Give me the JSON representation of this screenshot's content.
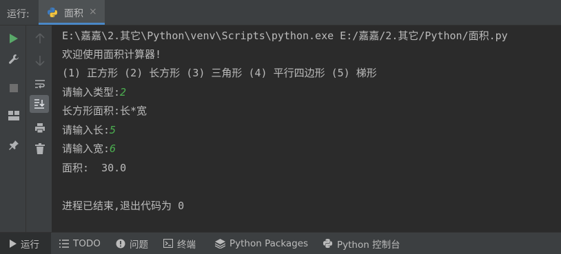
{
  "topbar": {
    "run_label": "运行:",
    "tab_title": "面积",
    "tab_close": "×"
  },
  "console": {
    "lines": [
      "E:\\嘉嘉\\2.其它\\Python\\venv\\Scripts\\python.exe E:/嘉嘉/2.其它/Python/面积.py",
      "欢迎使用面积计算器!",
      "(1) 正方形 (2) 长方形 (3) 三角形 (4) 平行四边形 (5) 梯形",
      "请输入类型:",
      "长方形面积:长*宽",
      "请输入长:",
      "请输入宽:",
      "面积:  30.0",
      "",
      "进程已结束,退出代码为 0"
    ],
    "inputs": {
      "type": "2",
      "length": "5",
      "width": "6"
    },
    "input_color": "#4caf50"
  },
  "bottombar": {
    "items": [
      {
        "label": "运行",
        "icon": "play-icon",
        "active": true
      },
      {
        "label": "TODO",
        "icon": "list-icon"
      },
      {
        "label": "问题",
        "icon": "info-icon"
      },
      {
        "label": "终端",
        "icon": "terminal-icon"
      },
      {
        "label": "Python Packages",
        "icon": "layers-icon"
      },
      {
        "label": "Python 控制台",
        "icon": "python-icon"
      }
    ]
  },
  "colors": {
    "accent": "#4a88c7",
    "run_green": "#59a869",
    "panel_bg": "#3c3f41",
    "console_bg": "#2b2b2b"
  }
}
